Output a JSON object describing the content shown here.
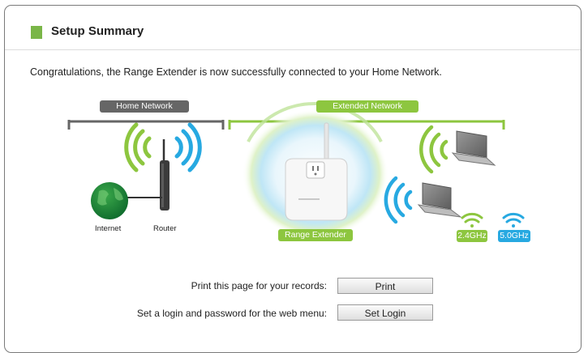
{
  "header": {
    "title": "Setup Summary"
  },
  "message": "Congratulations, the Range Extender is now successfully connected to your Home Network.",
  "diagram": {
    "home_network_label": "Home Network",
    "extended_network_label": "Extended Network",
    "internet_label": "Internet",
    "router_label": "Router",
    "extender_label": "Range Extender",
    "band_24_label": "2.4GHz",
    "band_50_label": "5.0GHz",
    "colors": {
      "home": "#666666",
      "extended": "#8dc63f",
      "band_24": "#8dc63f",
      "band_50": "#27a9e1"
    }
  },
  "actions": {
    "print_text": "Print this page for your records:",
    "print_button": "Print",
    "login_text": "Set a login and password for the web menu:",
    "login_button": "Set Login"
  }
}
